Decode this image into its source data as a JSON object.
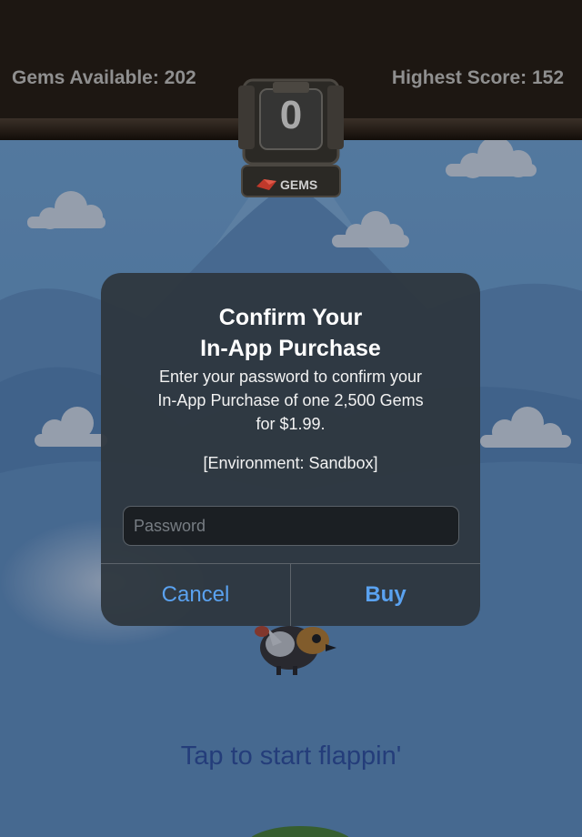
{
  "hud": {
    "gems_available": "Gems Available: 202",
    "highest_score": "Highest Score: 152",
    "score": "0",
    "gems_tag": "GEMS"
  },
  "dialog": {
    "title_line1": "Confirm Your",
    "title_line2": "In-App Purchase",
    "message_line1": "Enter your password to confirm your",
    "message_line2": "In-App Purchase of one 2,500 Gems",
    "message_line3": "for $1.99.",
    "environment": "[Environment: Sandbox]",
    "password_placeholder": "Password",
    "cancel_label": "Cancel",
    "buy_label": "Buy"
  },
  "footer": {
    "tap_prompt": "Tap to start flappin'"
  },
  "colors": {
    "sky": "#7bb0de",
    "accent_button": "#5aa2f0",
    "dialog_bg": "#2e363e"
  }
}
